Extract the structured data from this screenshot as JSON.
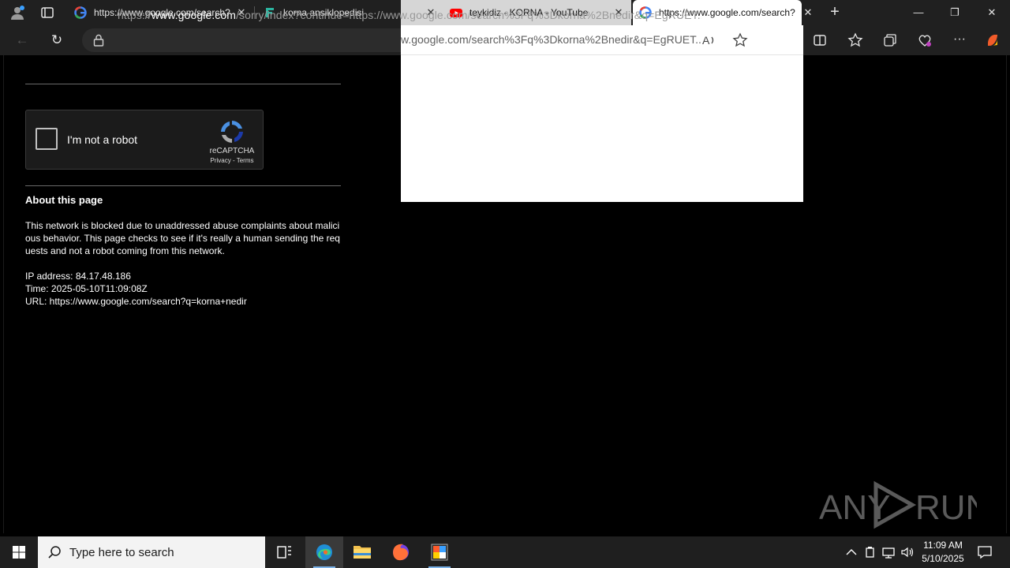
{
  "tabs": [
    {
      "title": "https://www.google.com/search?q=",
      "favicon": "google-icon",
      "state": "inactive"
    },
    {
      "title": "korna ansiklopedisi",
      "favicon": "site-icon",
      "state": "inactive"
    },
    {
      "title": "teykidiz - KORNA - YouTube",
      "favicon": "youtube-icon",
      "state": "inactive"
    },
    {
      "title": "https://www.google.com/search?q=",
      "favicon": "google-icon",
      "state": "active"
    }
  ],
  "address_bar": {
    "url_prefix": "https://",
    "url_domain": "www.google.com",
    "url_path": "/sorry/index?continue=https://www.google.com/search%3Fq%3Dkorna%2Bnedir&q=EgRUET..."
  },
  "popup": {
    "url_visible": "w.google.com/search%3Fq%3Dkorna%2Bnedir&q=EgRUET..."
  },
  "captcha": {
    "label": "I'm not a robot",
    "brand": "reCAPTCHA",
    "links": "Privacy - Terms"
  },
  "about": {
    "title": "About this page",
    "body": "This network is blocked due to unaddressed abuse complaints about malicious behavior. This page checks to see if it's really a human sending the requests and not a robot coming from this network.",
    "ip_line": "IP address: 84.17.48.186",
    "time_line": "Time: 2025-05-10T11:09:08Z",
    "url_line": "URL: https://www.google.com/search?q=korna+nedir"
  },
  "taskbar": {
    "search_placeholder": "Type here to search",
    "time": "11:09 AM",
    "date": "5/10/2025"
  },
  "colors": {
    "youtube_red": "#ff0000",
    "edge_accent": "#7bb2e8"
  }
}
